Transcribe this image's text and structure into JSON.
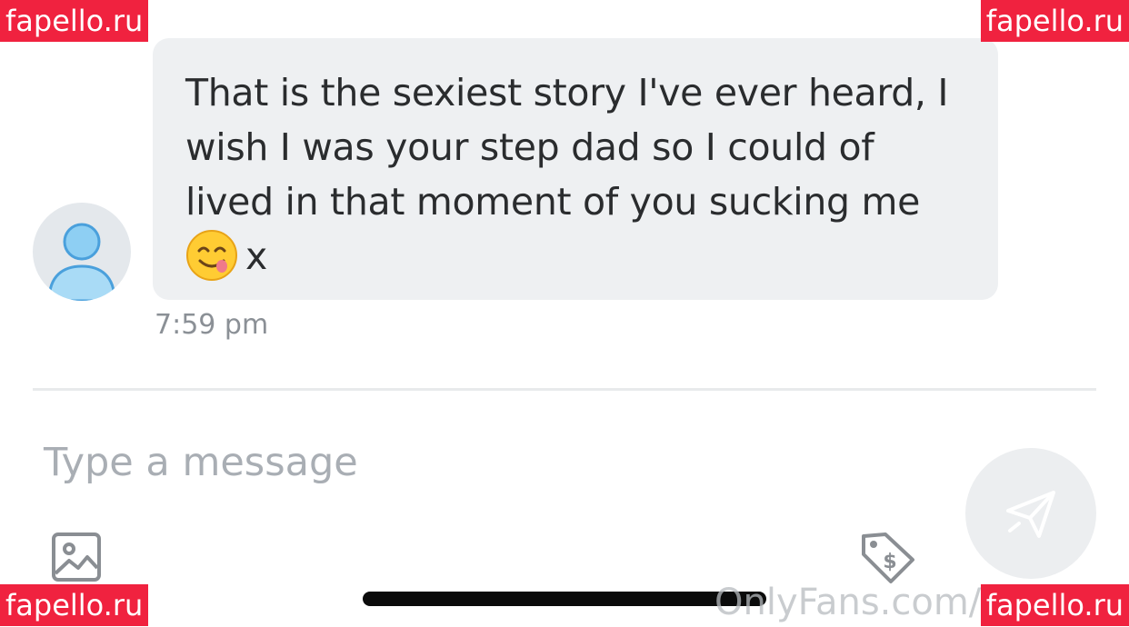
{
  "message": {
    "text": "That is the sexiest story I've ever heard, I wish I was your step dad so I could of lived in that moment of you sucking me",
    "emoji_icon": "face-savoring-food-emoji",
    "suffix": "x",
    "time": "7:59 pm"
  },
  "composer": {
    "placeholder": "Type a message",
    "media_icon": "image-icon",
    "price_icon": "price-tag-icon",
    "send_icon": "paper-plane-icon"
  },
  "overlay": {
    "site_text": "OnlyFans.com/k",
    "watermarks": [
      "fapello.ru",
      "fapello.ru",
      "fapello.ru",
      "fapello.ru"
    ]
  },
  "colors": {
    "bubble": "#eef0f2",
    "watermark_bg": "#f0223f",
    "avatar_blue": "#7ec3ec"
  }
}
